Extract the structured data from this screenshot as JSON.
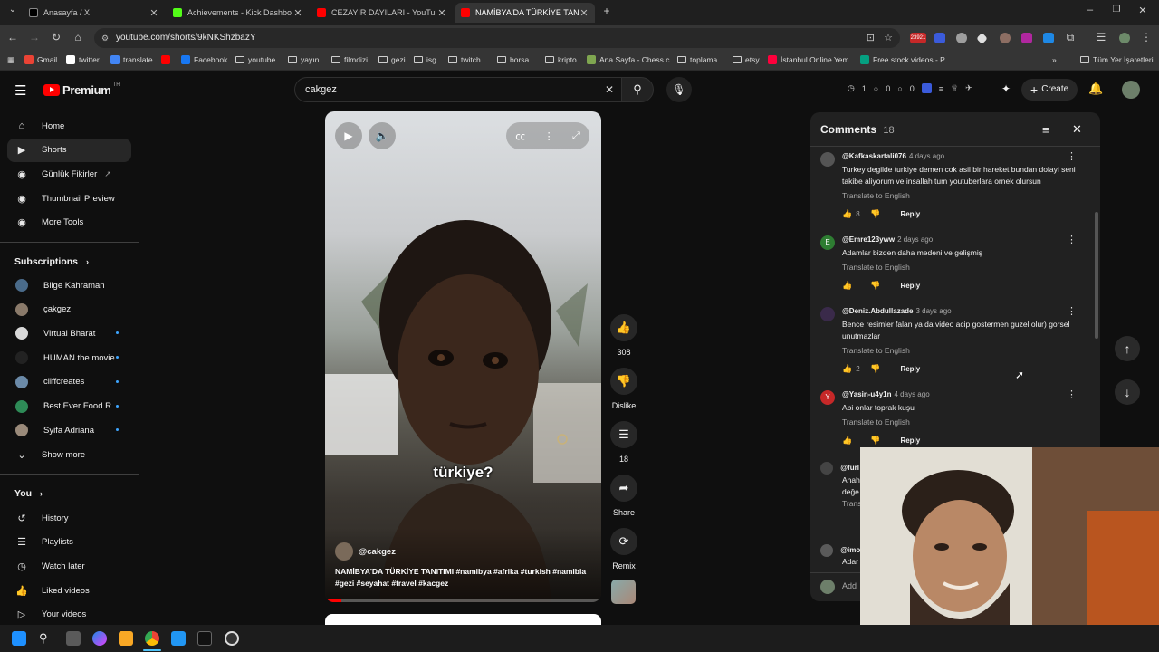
{
  "browser": {
    "tabs": [
      {
        "title": "Anasayfa / X",
        "color": "#000000",
        "active": false
      },
      {
        "title": "Achievements - Kick Dashboard",
        "color": "#53fc18",
        "active": false
      },
      {
        "title": "CEZAYİR DAYILARI - YouTube",
        "color": "#ff0000",
        "active": false
      },
      {
        "title": "NAMİBYA'DA TÜRKİYE TANITIM",
        "color": "#ff0000",
        "active": true
      }
    ],
    "new_tab": "+",
    "url": "youtube.com/shorts/9kNKShzbazY",
    "bookmarks": [
      {
        "label": "Gmail",
        "kind": "icon",
        "color": "#ea4335"
      },
      {
        "label": "twitter",
        "kind": "icon",
        "color": "#ffffff"
      },
      {
        "label": "translate",
        "kind": "icon",
        "color": "#4285f4"
      },
      {
        "label": "",
        "kind": "icon",
        "color": "#ff0000"
      },
      {
        "label": "Facebook",
        "kind": "icon",
        "color": "#1877f2"
      },
      {
        "label": "youtube",
        "kind": "folder"
      },
      {
        "label": "yayın",
        "kind": "folder"
      },
      {
        "label": "filmdizi",
        "kind": "folder"
      },
      {
        "label": "gezi",
        "kind": "folder"
      },
      {
        "label": "isg",
        "kind": "folder"
      },
      {
        "label": "twitch",
        "kind": "folder"
      },
      {
        "label": "borsa",
        "kind": "folder"
      },
      {
        "label": "kripto",
        "kind": "folder"
      },
      {
        "label": "Ana Sayfa - Chess.c...",
        "kind": "icon",
        "color": "#7fa650"
      },
      {
        "label": "toplama",
        "kind": "folder"
      },
      {
        "label": "etsy",
        "kind": "folder"
      },
      {
        "label": "İstanbul Online Yem...",
        "kind": "icon",
        "color": "#ff003c"
      },
      {
        "label": "Free stock videos - P...",
        "kind": "icon",
        "color": "#05a081"
      }
    ],
    "all_bookmarks": "Tüm Yer İşaretleri",
    "badge": "23921"
  },
  "youtube": {
    "logo": "Premium",
    "logo_region": "TR",
    "search_value": "cakgez",
    "create_label": "Create",
    "header_counters": [
      "1",
      "0",
      "0"
    ],
    "sidebar": {
      "items": [
        {
          "label": "Home",
          "icon": "home-icon",
          "glyph": "⌂"
        },
        {
          "label": "Shorts",
          "icon": "shorts-icon",
          "glyph": "▶"
        },
        {
          "label": "Günlük Fikirler",
          "icon": "ext-icon",
          "glyph": "◉"
        },
        {
          "label": "Thumbnail Preview",
          "icon": "ext-icon",
          "glyph": "◉"
        },
        {
          "label": "More Tools",
          "icon": "ext-icon",
          "glyph": "◉"
        }
      ],
      "subscriptions_header": "Subscriptions",
      "subscriptions": [
        {
          "label": "Bilge Kahraman",
          "color": "#4a6b8a",
          "dot": false
        },
        {
          "label": "çakgez",
          "color": "#8a7a6a",
          "dot": false
        },
        {
          "label": "Virtual Bharat",
          "color": "#d8d8d8",
          "dot": true
        },
        {
          "label": "HUMAN the movie",
          "color": "#222222",
          "dot": true
        },
        {
          "label": "cliffcreates",
          "color": "#6b8aa8",
          "dot": true
        },
        {
          "label": "Best Ever Food R...",
          "color": "#2e8b57",
          "dot": true
        },
        {
          "label": "Syifa Adriana",
          "color": "#9a8a7a",
          "dot": true
        }
      ],
      "show_more": "Show more",
      "you_header": "You",
      "you_items": [
        {
          "label": "History",
          "glyph": "↺"
        },
        {
          "label": "Playlists",
          "glyph": "☰"
        },
        {
          "label": "Watch later",
          "glyph": "◷"
        },
        {
          "label": "Liked videos",
          "glyph": "👍"
        },
        {
          "label": "Your videos",
          "glyph": "▷"
        }
      ]
    },
    "short": {
      "caption": "türkiye?",
      "channel": "@cakgez",
      "title": "NAMİBYA'DA TÜRKİYE TANITIMI #namibya #afrika #turkish #namibia #gezi #seyahat #travel #kacgez",
      "progress": 0.06,
      "actions": [
        {
          "label": "308",
          "icon": "like-icon",
          "glyph": "👍"
        },
        {
          "label": "Dislike",
          "icon": "dislike-icon",
          "glyph": "👎"
        },
        {
          "label": "18",
          "icon": "comment-icon",
          "glyph": "☰"
        },
        {
          "label": "Share",
          "icon": "share-icon",
          "glyph": "➦"
        },
        {
          "label": "Remix",
          "icon": "remix-icon",
          "glyph": "⟳"
        }
      ]
    },
    "comments": {
      "title": "Comments",
      "count": "18",
      "add_placeholder": "Add",
      "items": [
        {
          "handle": "@Kafkaskartali076",
          "ago": "4 days ago",
          "text": "Turkey degilde turkiye demen cok asil bir hareket bundan dolayi seni takibe aliyorum ve insallah tum youtuberlara ornek olursun",
          "likes": "8",
          "avatar_color": "#555555",
          "initial": ""
        },
        {
          "handle": "@Emre123yww",
          "ago": "2 days ago",
          "text": "Adamlar bizden daha medeni ve gelişmiş",
          "likes": "",
          "avatar_color": "#2e7d32",
          "initial": "E"
        },
        {
          "handle": "@Deniz.Abdullazade",
          "ago": "3 days ago",
          "text": "Bence resimler falan ya da video acip gostermen guzel olur) gorsel unutmazlar",
          "likes": "2",
          "avatar_color": "#3a2a4a",
          "initial": ""
        },
        {
          "handle": "@Yasin-u4y1n",
          "ago": "4 days ago",
          "text": "Abi onlar toprak kuşu",
          "likes": "",
          "avatar_color": "#c62828",
          "initial": "Y"
        }
      ],
      "translate_label": "Translate to English",
      "reply_label": "Reply",
      "partial": [
        {
          "handle": "@furl",
          "lines": [
            "Ahah",
            "değe",
            "Trans"
          ]
        },
        {
          "handle": "@imo",
          "lines": [
            "Adar"
          ]
        }
      ]
    }
  }
}
